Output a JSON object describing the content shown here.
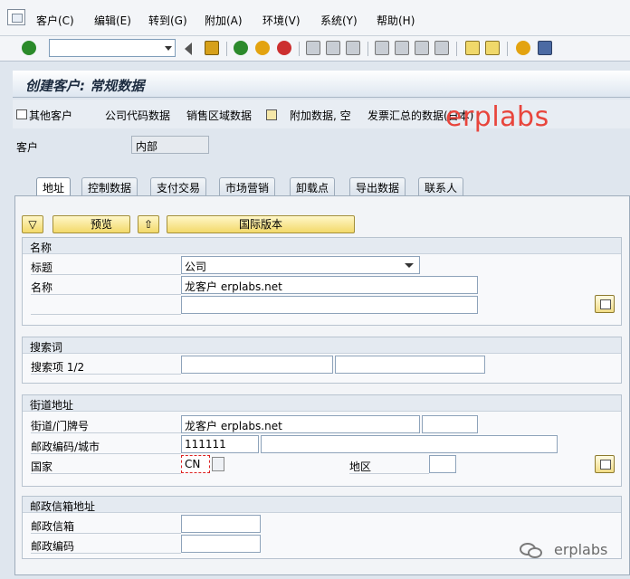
{
  "menu": [
    "客户(C)",
    "编辑(E)",
    "转到(G)",
    "附加(A)",
    "环境(V)",
    "系统(Y)",
    "帮助(H)"
  ],
  "title": "创建客户: 常规数据",
  "app_toolbar": [
    "其他客户",
    "公司代码数据",
    "销售区域数据",
    "附加数据, 空",
    "发票汇总的数据(日本)"
  ],
  "watermark": "erplabs",
  "customer": {
    "label": "客户",
    "value": "内部"
  },
  "tabs": [
    "地址",
    "控制数据",
    "支付交易",
    "市场营销",
    "卸载点",
    "导出数据",
    "联系人"
  ],
  "buttons": {
    "preview": "预览",
    "intl_version": "国际版本"
  },
  "name_group": {
    "title": "名称",
    "title_label": "标题",
    "title_value": "公司",
    "name_label": "名称",
    "name_value": "龙客户 erplabs.net",
    "name2_value": ""
  },
  "search_group": {
    "title": "搜索词",
    "label": "搜索项 1/2",
    "value1": "",
    "value2": ""
  },
  "street_group": {
    "title": "街道地址",
    "street_label": "街道/门牌号",
    "street_value": "龙客户 erplabs.net",
    "house_no": "",
    "postal_label": "邮政编码/城市",
    "postal_value": "111111",
    "city_value": "",
    "country_label": "国家",
    "country_value": "CN",
    "region_label": "地区",
    "region_value": ""
  },
  "pobox_group": {
    "title": "邮政信箱地址",
    "pobox_label": "邮政信箱",
    "pobox_value": "",
    "postal_label": "邮政编码",
    "postal_value": ""
  },
  "footer_mark": "erplabs",
  "colors": {
    "accent": "#e8453c",
    "title": "#1d2c40"
  }
}
